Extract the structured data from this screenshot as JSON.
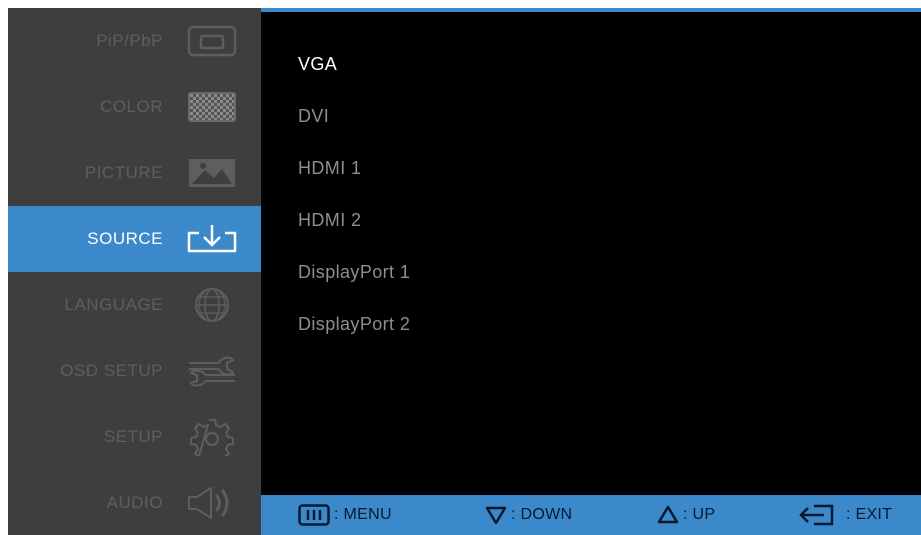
{
  "sidebar": {
    "items": [
      {
        "label": "PiP/PbP",
        "icon": "pip-icon",
        "active": false
      },
      {
        "label": "COLOR",
        "icon": "color-checker-icon",
        "active": false
      },
      {
        "label": "PICTURE",
        "icon": "picture-icon",
        "active": false
      },
      {
        "label": "SOURCE",
        "icon": "source-input-icon",
        "active": true
      },
      {
        "label": "LANGUAGE",
        "icon": "globe-icon",
        "active": false
      },
      {
        "label": "OSD SETUP",
        "icon": "wrench-icon",
        "active": false
      },
      {
        "label": "SETUP",
        "icon": "gear-icon",
        "active": false
      },
      {
        "label": "AUDIO",
        "icon": "speaker-icon",
        "active": false
      }
    ]
  },
  "content": {
    "sources": [
      "VGA",
      "DVI",
      "HDMI 1",
      "HDMI 2",
      "DisplayPort 1",
      "DisplayPort 2"
    ],
    "selected_source": "VGA"
  },
  "footer": {
    "menu_label": ": MENU",
    "down_label": ": DOWN",
    "up_label": ": UP",
    "exit_label": ": EXIT"
  },
  "colors": {
    "accent": "#3b89cb",
    "sidebar_bg": "#3e3e3e",
    "inactive_text": "#5e5e5e",
    "content_bg": "#000000"
  }
}
